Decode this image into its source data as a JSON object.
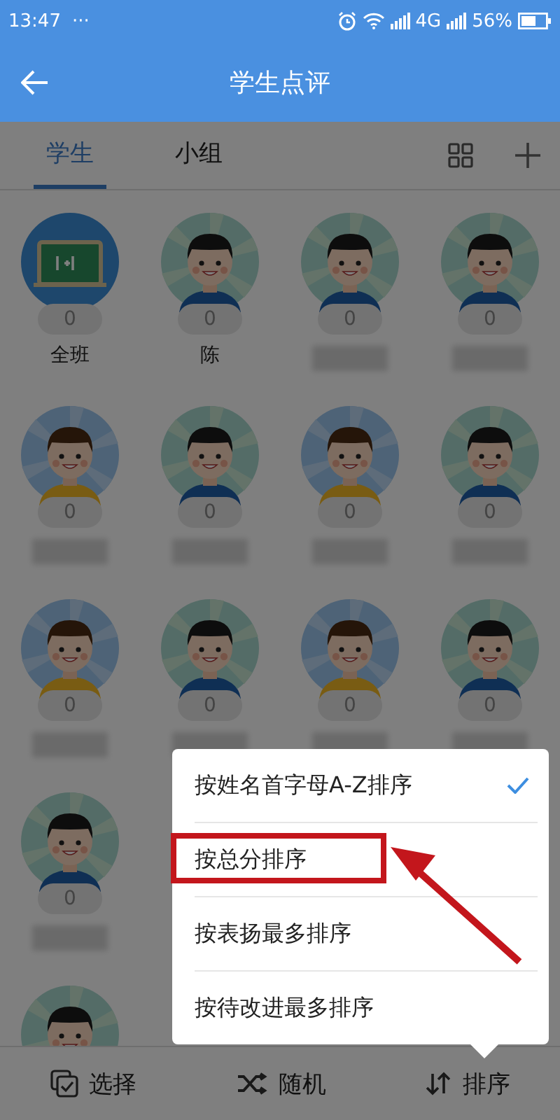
{
  "status_bar": {
    "time": "13:47",
    "dots": "···",
    "network": "4G",
    "battery": "56%"
  },
  "app_bar": {
    "title": "学生点评"
  },
  "tabs": [
    {
      "label": "学生",
      "selected": true
    },
    {
      "label": "小组",
      "selected": false
    }
  ],
  "grid_rows": [
    [
      {
        "kind": "class",
        "score": "0",
        "name": "全班"
      },
      {
        "kind": "boy_a",
        "score": "0",
        "name": "陈"
      },
      {
        "kind": "boy_a",
        "score": "0"
      },
      {
        "kind": "boy_a",
        "score": "0"
      }
    ],
    [
      {
        "kind": "boy_b",
        "score": "0"
      },
      {
        "kind": "boy_a",
        "score": "0"
      },
      {
        "kind": "boy_b",
        "score": "0"
      },
      {
        "kind": "boy_a",
        "score": "0"
      }
    ],
    [
      {
        "kind": "boy_b",
        "score": "0"
      },
      {
        "kind": "boy_a",
        "score": "0"
      },
      {
        "kind": "boy_b",
        "score": "0"
      },
      {
        "kind": "boy_a",
        "score": "0"
      }
    ],
    [
      {
        "kind": "boy_a",
        "score": "0"
      }
    ],
    [
      {
        "kind": "boy_a"
      }
    ]
  ],
  "sort_menu": [
    {
      "label": "按姓名首字母A-Z排序",
      "selected": true,
      "highlighted": false
    },
    {
      "label": "按总分排序",
      "selected": false,
      "highlighted": true
    },
    {
      "label": "按表扬最多排序",
      "selected": false,
      "highlighted": false
    },
    {
      "label": "按待改进最多排序",
      "selected": false,
      "highlighted": false
    }
  ],
  "bottom_bar": [
    {
      "kind": "select",
      "label": "选择"
    },
    {
      "kind": "random",
      "label": "随机"
    },
    {
      "kind": "sort",
      "label": "排序"
    }
  ]
}
